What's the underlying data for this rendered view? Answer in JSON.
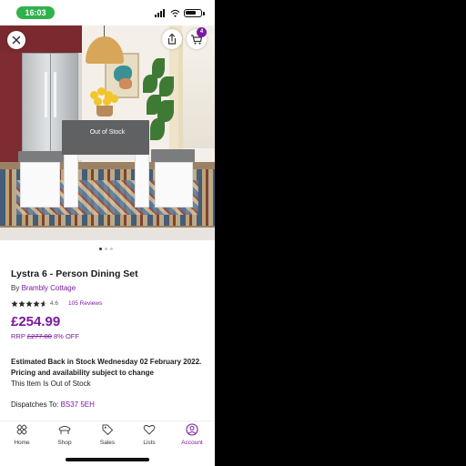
{
  "status_bar": {
    "time": "16:03"
  },
  "hero": {
    "overlay_label": "Out of Stock",
    "cart_count": "4"
  },
  "product": {
    "title": "Lystra 6 - Person Dining Set",
    "by_label": "By",
    "brand": "Brambly Cottage",
    "rating": "4.6",
    "reviews": "105 Reviews",
    "rating_stars_filled": 4.6,
    "price": "£254.99",
    "rrp_label": "RRP",
    "rrp_price": "£277.80",
    "discount": "8% OFF"
  },
  "stock": {
    "back_in_stock": "Estimated Back in Stock Wednesday 02 February 2022.",
    "pricing_note": "Pricing and availability subject to change",
    "status": "This Item Is Out of Stock",
    "dispatch_label": "Dispatches To:",
    "postcode": "BS37 5EH"
  },
  "bottom_nav": {
    "items": [
      {
        "label": "Home",
        "icon": "home-icon"
      },
      {
        "label": "Shop",
        "icon": "shop-icon"
      },
      {
        "label": "Sales",
        "icon": "sales-tag-icon"
      },
      {
        "label": "Lists",
        "icon": "heart-icon"
      },
      {
        "label": "Account",
        "icon": "account-icon"
      }
    ]
  },
  "colors": {
    "accent": "#7b189f",
    "status_pill": "#2fb24c"
  }
}
